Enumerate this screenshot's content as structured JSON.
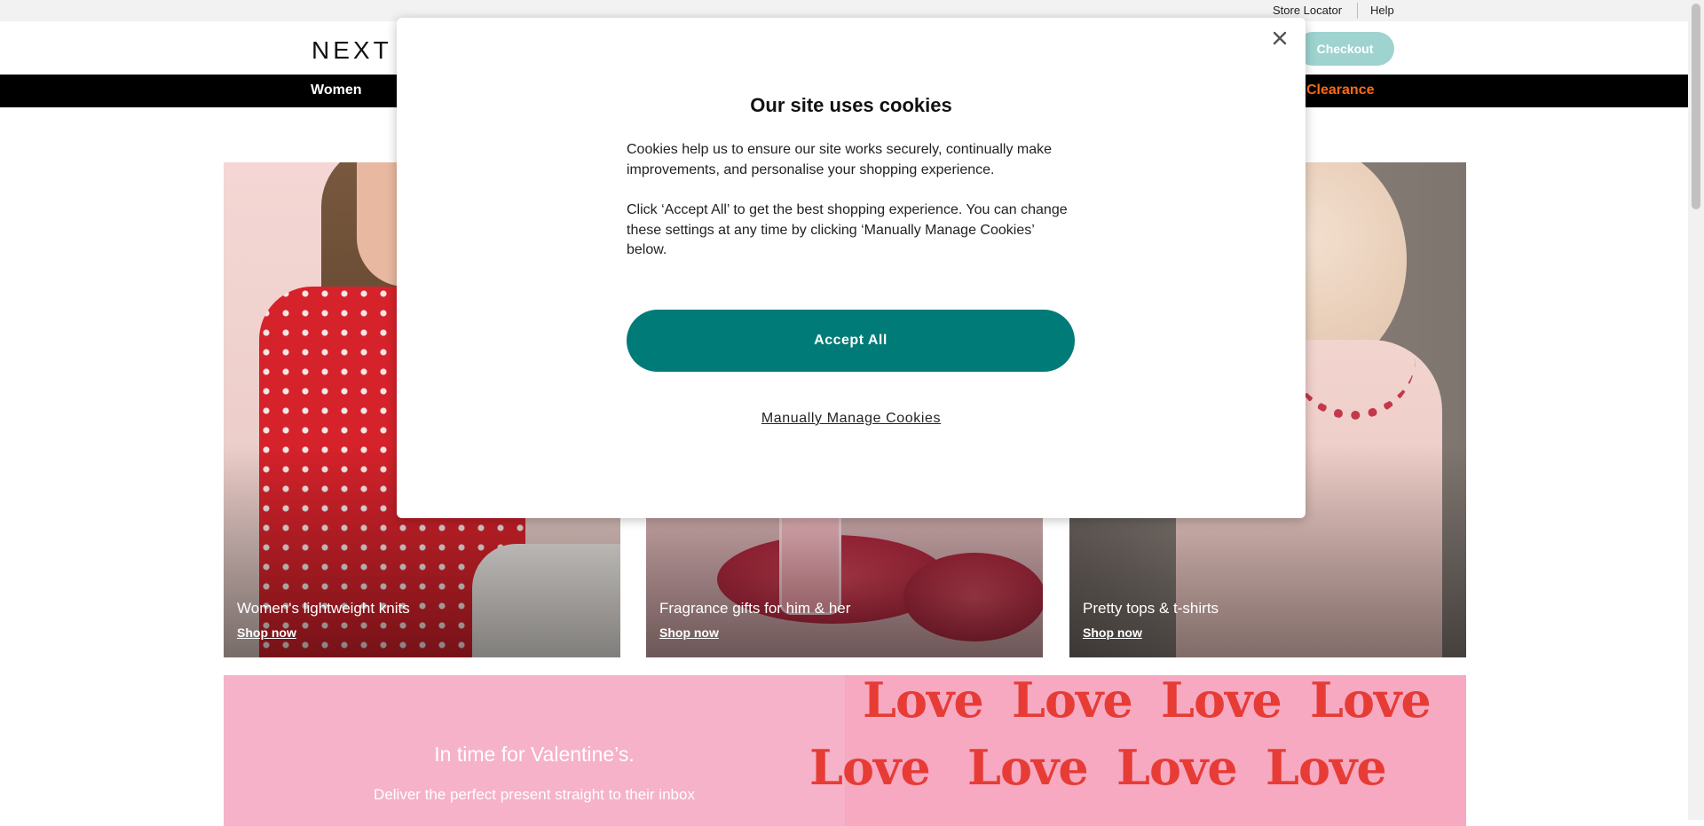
{
  "utility": {
    "store_locator": "Store Locator",
    "help": "Help"
  },
  "header": {
    "logo": "NEXT",
    "checkout": "Checkout"
  },
  "nav": {
    "women": "Women",
    "clearance": "Clearance"
  },
  "tiles": [
    {
      "title": "Women's lightweight knits",
      "link": "Shop now"
    },
    {
      "title": "Fragrance gifts for him & her",
      "link": "Shop now"
    },
    {
      "title": "Pretty tops & t-shirts",
      "link": "Shop now"
    }
  ],
  "banner": {
    "title": "In time for Valentine’s.",
    "subtitle": "Deliver the perfect present straight to their inbox",
    "pattern_word": "Love"
  },
  "cookie_modal": {
    "title": "Our site uses cookies",
    "paragraph1": "Cookies help us to ensure our site works securely, continually make improvements, and personalise your shopping experience.",
    "paragraph2": "Click ‘Accept All’ to get the best shopping experience. You can change these settings at any time by clicking ‘Manually Manage Cookies’ below.",
    "accept_all": "Accept All",
    "manage": "Manually Manage Cookies",
    "close_icon": "close-icon"
  },
  "colors": {
    "accent_teal": "#007b77",
    "checkout_teal_light": "#9ed3d0",
    "clearance_orange": "#ff6a13",
    "nav_black": "#000000",
    "banner_pink": "#f5b2c8",
    "love_red": "#e63c35"
  }
}
